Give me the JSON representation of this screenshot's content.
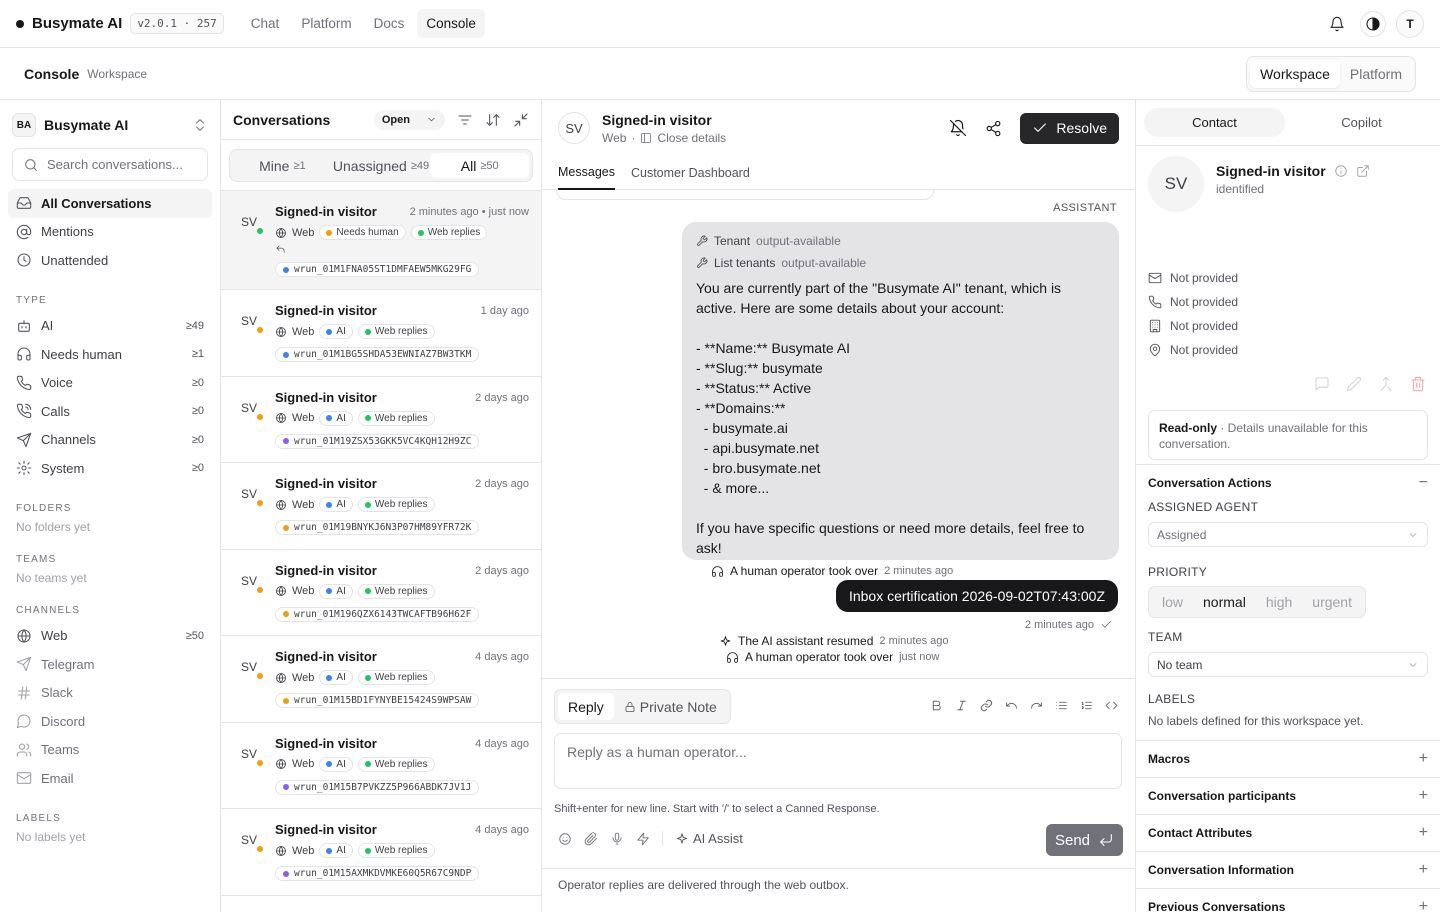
{
  "topbar": {
    "brand": "Busymate AI",
    "version": "v2.0.1 · 257",
    "nav": [
      "Chat",
      "Platform",
      "Docs",
      "Console"
    ],
    "active_nav": "Console",
    "user_initial": "T"
  },
  "subheader": {
    "title": "Console",
    "subtitle": "Workspace",
    "toggle": [
      "Workspace",
      "Platform"
    ]
  },
  "sidebar": {
    "workspace_initials": "BA",
    "workspace_name": "Busymate AI",
    "search_placeholder": "Search conversations...",
    "primary": [
      {
        "label": "All Conversations",
        "icon": "inbox-icon"
      },
      {
        "label": "Mentions",
        "icon": "at-sign-icon"
      },
      {
        "label": "Unattended",
        "icon": "clock-icon"
      }
    ],
    "type_heading": "TYPE",
    "types": [
      {
        "label": "AI",
        "count": "≥49",
        "icon": "bot-icon"
      },
      {
        "label": "Needs human",
        "count": "≥1",
        "icon": "headphones-icon"
      },
      {
        "label": "Voice",
        "count": "≥0",
        "icon": "phone-icon"
      },
      {
        "label": "Calls",
        "count": "≥0",
        "icon": "phone-call-icon"
      },
      {
        "label": "Channels",
        "count": "≥0",
        "icon": "send-icon"
      },
      {
        "label": "System",
        "count": "≥0",
        "icon": "gear-icon"
      }
    ],
    "folders_heading": "FOLDERS",
    "folders_empty": "No folders yet",
    "teams_heading": "TEAMS",
    "teams_empty": "No teams yet",
    "channels_heading": "CHANNELS",
    "channels": [
      {
        "label": "Web",
        "count": "≥50",
        "icon": "globe-icon"
      },
      {
        "label": "Telegram",
        "count": "",
        "icon": "send-icon"
      },
      {
        "label": "Slack",
        "count": "",
        "icon": "hash-icon"
      },
      {
        "label": "Discord",
        "count": "",
        "icon": "message-circle-icon"
      },
      {
        "label": "Teams",
        "count": "",
        "icon": "users-icon"
      },
      {
        "label": "Email",
        "count": "",
        "icon": "mail-icon"
      }
    ],
    "labels_heading": "LABELS",
    "labels_empty": "No labels yet"
  },
  "conversations": {
    "title": "Conversations",
    "status_filter": "Open",
    "tabs": [
      {
        "label": "Mine",
        "count": "≥1"
      },
      {
        "label": "Unassigned",
        "count": "≥49"
      },
      {
        "label": "All",
        "count": "≥50"
      }
    ],
    "items": [
      {
        "initials": "SV",
        "name": "Signed-in visitor",
        "time": "2 minutes ago • just now",
        "channel": "Web",
        "tag": "Needs human",
        "tag_color": "#f59e0b",
        "source": "Web replies",
        "run": "wrun_01M1FNA05ST1DMFAEW5MKG29FG",
        "run_color": "#3b82f6",
        "status_color": "#22c55e"
      },
      {
        "initials": "SV",
        "name": "Signed-in visitor",
        "time": "1 day ago",
        "channel": "Web",
        "tag": "AI",
        "tag_color": "#3b82f6",
        "source": "Web replies",
        "run": "wrun_01M1BG5SHDA53EWNIAZ7BW3TKM",
        "run_color": "#3b82f6",
        "status_color": "#f59e0b"
      },
      {
        "initials": "SV",
        "name": "Signed-in visitor",
        "time": "2 days ago",
        "channel": "Web",
        "tag": "AI",
        "tag_color": "#3b82f6",
        "source": "Web replies",
        "run": "wrun_01M19ZSX53GKK5VC4KQH12H9ZC",
        "run_color": "#8b5cf6",
        "status_color": "#f59e0b"
      },
      {
        "initials": "SV",
        "name": "Signed-in visitor",
        "time": "2 days ago",
        "channel": "Web",
        "tag": "AI",
        "tag_color": "#3b82f6",
        "source": "Web replies",
        "run": "wrun_01M19BNYKJ6N3P07HM89YFR72K",
        "run_color": "#f59e0b",
        "status_color": "#f59e0b"
      },
      {
        "initials": "SV",
        "name": "Signed-in visitor",
        "time": "2 days ago",
        "channel": "Web",
        "tag": "AI",
        "tag_color": "#3b82f6",
        "source": "Web replies",
        "run": "wrun_01M196QZX6143TWCAFTB96H62F",
        "run_color": "#f59e0b",
        "status_color": "#f59e0b"
      },
      {
        "initials": "SV",
        "name": "Signed-in visitor",
        "time": "4 days ago",
        "channel": "Web",
        "tag": "AI",
        "tag_color": "#3b82f6",
        "source": "Web replies",
        "run": "wrun_01M15BD1FYNYBE15424S9WPSAW",
        "run_color": "#f59e0b",
        "status_color": "#f59e0b"
      },
      {
        "initials": "SV",
        "name": "Signed-in visitor",
        "time": "4 days ago",
        "channel": "Web",
        "tag": "AI",
        "tag_color": "#3b82f6",
        "source": "Web replies",
        "run": "wrun_01M15B7PVKZZ5P966ABDK7JV1J",
        "run_color": "#8b5cf6",
        "status_color": "#f59e0b"
      },
      {
        "initials": "SV",
        "name": "Signed-in visitor",
        "time": "4 days ago",
        "channel": "Web",
        "tag": "AI",
        "tag_color": "#3b82f6",
        "source": "Web replies",
        "run": "wrun_01M15AXMKDVMKE60Q5R67C9NDP",
        "run_color": "#8b5cf6",
        "status_color": "#f59e0b"
      }
    ]
  },
  "chat": {
    "initials": "SV",
    "name": "Signed-in visitor",
    "channel": "Web",
    "close_details": "Close details",
    "resolve_label": "Resolve",
    "tabs": [
      "Messages",
      "Customer Dashboard"
    ],
    "role_label": "ASSISTANT",
    "tool_calls": [
      {
        "name": "Tenant",
        "status": "output-available"
      },
      {
        "name": "List tenants",
        "status": "output-available"
      }
    ],
    "assistant_message": "You are currently part of the \"Busymate AI\" tenant, which is active. Here are some details about your account:\n\n- **Name:** Busymate AI\n- **Slug:** busymate\n- **Status:** Active\n- **Domains:**\n  - busymate.ai\n  - api.busymate.net\n  - bro.busymate.net\n  - & more...\n\nIf you have specific questions or need more details, feel free to ask!",
    "event1": {
      "text": "A human operator took over",
      "time": "2 minutes ago"
    },
    "operator_message": "Inbox certification 2026-09-02T07:43:00Z",
    "operator_time": "2 minutes ago",
    "event2": {
      "text": "The AI assistant resumed",
      "time": "2 minutes ago"
    },
    "event3": {
      "text": "A human operator took over",
      "time": "just now"
    },
    "reply_tabs": [
      "Reply",
      "Private Note"
    ],
    "reply_placeholder": "Reply as a human operator...",
    "hint": "Shift+enter for new line. Start with '/' to select a Canned Response.",
    "ai_assist": "AI Assist",
    "send_label": "Send",
    "footnote": "Operator replies are delivered through the web outbox."
  },
  "contact_panel": {
    "tabs": [
      "Contact",
      "Copilot"
    ],
    "initials": "SV",
    "name": "Signed-in visitor",
    "status": "identified",
    "fields": [
      "Not provided",
      "Not provided",
      "Not provided",
      "Not provided"
    ],
    "readonly_bold": "Read-only",
    "readonly_text": " · Details unavailable for this conversation.",
    "actions_title": "Conversation Actions",
    "assigned_label": "ASSIGNED AGENT",
    "assigned_value": "Assigned",
    "priority_label": "PRIORITY",
    "priorities": [
      "low",
      "normal",
      "high",
      "urgent"
    ],
    "priority_selected": "normal",
    "team_label": "TEAM",
    "team_value": "No team",
    "labels_label": "LABELS",
    "labels_empty": "No labels defined for this workspace yet.",
    "sections": [
      "Macros",
      "Conversation participants",
      "Contact Attributes",
      "Conversation Information",
      "Previous Conversations"
    ]
  }
}
